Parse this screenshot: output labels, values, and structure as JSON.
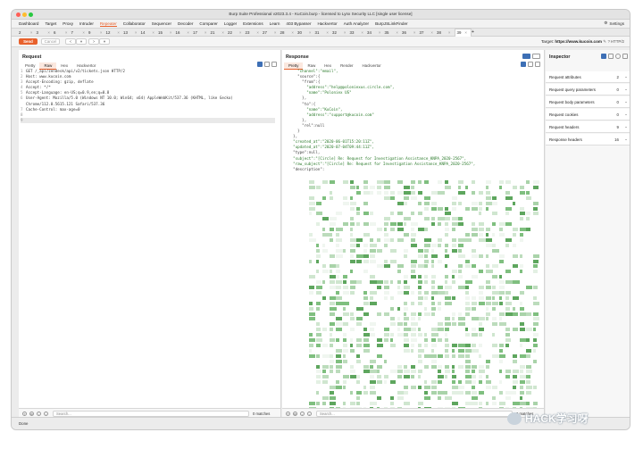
{
  "window": {
    "title": "Burp Suite Professional v2023.3.4 - KuCoin.burp - licensed to Lynx Security LLC [single user license]",
    "traffic_colors": [
      "#ff5f57",
      "#febc2e",
      "#28c840"
    ]
  },
  "menubar": {
    "items": [
      "Dashboard",
      "Target",
      "Proxy",
      "Intruder",
      "Repeater",
      "Collaborator",
      "Sequencer",
      "Decoder",
      "Comparer",
      "Logger",
      "Extensions",
      "Learn",
      "403 Bypasser",
      "Hackvertor",
      "Auth Analyzer",
      "BurpJSLinkFinder"
    ],
    "active": "Repeater",
    "settings_label": "Settings"
  },
  "repeater_tabs": {
    "items": [
      "2",
      "3",
      "6",
      "7",
      "9",
      "12",
      "13",
      "14",
      "15",
      "16",
      "17",
      "21",
      "22",
      "23",
      "27",
      "28",
      "30",
      "31",
      "32",
      "33",
      "34",
      "35",
      "36",
      "37",
      "38",
      "39"
    ],
    "active": "39",
    "close_glyph": "×",
    "add_glyph": "+"
  },
  "toolbar": {
    "send_label": "Send",
    "cancel_label": "Cancel",
    "nav": [
      "<",
      "▾",
      ">",
      "▾"
    ],
    "target_label": "Target:",
    "target_value": "https://www.kucoin.com",
    "http_version": "HTTP/2"
  },
  "request": {
    "title": "Request",
    "subtabs": [
      "Pretty",
      "Raw",
      "Hex",
      "Hackvertor"
    ],
    "active_subtab": "Raw",
    "lines": [
      "GET /_api/zendesk/api/v2/tickets.json HTTP/2",
      "Host: www.kucoin.com",
      "Accept-Encoding: gzip, deflate",
      "Accept: */*",
      "Accept-Language: en-US;q=0.9,en;q=0.8",
      "User-Agent: Mozilla/5.0 (Windows NT 10.0; Win64; x64) AppleWebKit/537.36 (KHTML, like Gecko)",
      "Chrome/112.0.5615.121 Safari/537.36",
      "Cache-Control: max-age=0",
      "",
      ""
    ],
    "line_numbers": [
      "1",
      "2",
      "3",
      "4",
      "5",
      "6",
      "",
      "7",
      "8",
      "9"
    ],
    "search_placeholder": "Search...",
    "matches": "0 matches"
  },
  "response": {
    "title": "Response",
    "subtabs": [
      "Pretty",
      "Raw",
      "Hex",
      "Render",
      "Hackvertor"
    ],
    "active_subtab": "Pretty",
    "lines": [
      "      \"channel\":\"email\",",
      "      \"source\":{",
      "        \"from\":{",
      "          \"address\":\"help@poloniexus.circle.com\",",
      "          \"name\":\"Poloniex US\"",
      "        },",
      "        \"to\":{",
      "          \"name\":\"KuCoin\",",
      "          \"address\":\"support@kucoin.com\"",
      "        },",
      "        \"rel\":null",
      "      }",
      "    },",
      "    \"created_at\":\"2020-06-01T15:20:11Z\",",
      "    \"updated_at\":\"2020-07-04T09:44:11Z\",",
      "    \"type\":null,",
      "    \"subject\":\"[Circle] Re: Request for Investigation Assistance_KNPA_2020-2567\",",
      "    \"raw_subject\":\"[Circle] Re: Request for Investigation Assistance_KNPA_2020-2567\",",
      "    \"description\":"
    ],
    "search_placeholder": "Search...",
    "matches": "0 matches"
  },
  "inspector": {
    "title": "Inspector",
    "rows": [
      {
        "label": "Request attributes",
        "count": "2"
      },
      {
        "label": "Request query parameters",
        "count": "0"
      },
      {
        "label": "Request body parameters",
        "count": "0"
      },
      {
        "label": "Request cookies",
        "count": "0"
      },
      {
        "label": "Request headers",
        "count": "9"
      },
      {
        "label": "Response headers",
        "count": "16"
      }
    ]
  },
  "status": {
    "text": "Done"
  },
  "watermark": {
    "text": "HACK学习呀"
  }
}
